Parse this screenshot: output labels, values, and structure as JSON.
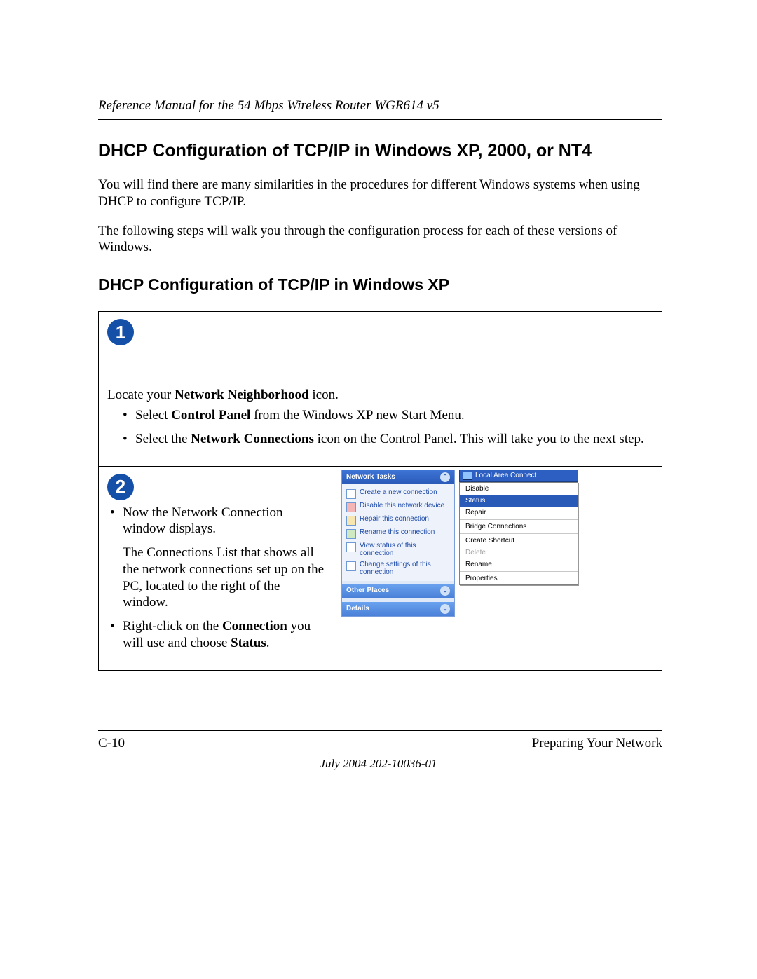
{
  "header": {
    "running_head": "Reference Manual for the 54 Mbps Wireless Router WGR614 v5"
  },
  "headings": {
    "h2": "DHCP Configuration of TCP/IP in Windows XP, 2000, or NT4",
    "h3": "DHCP Configuration of TCP/IP in Windows XP"
  },
  "paragraphs": {
    "p1": "You will find there are many similarities in the procedures for different Windows systems when using DHCP to configure TCP/IP.",
    "p2": "The following steps will walk you through the configuration process for each of these versions of Windows."
  },
  "step1": {
    "badge": "1",
    "lead_pre": "Locate your ",
    "lead_bold": "Network Neighborhood",
    "lead_post": " icon.",
    "b1_pre": "Select ",
    "b1_bold": "Control Panel",
    "b1_post": " from the Windows XP new Start Menu.",
    "b2_pre": "Select the ",
    "b2_bold": "Network Connections",
    "b2_post": " icon on the Control Panel.  This will take you to the next step."
  },
  "step2": {
    "badge": "2",
    "b1": "Now the Network Connection window displays.",
    "b1_follow": "The Connections List that shows all the network connections set up on the PC, located to the right of the window.",
    "b2_pre": "Right-click on the ",
    "b2_bold1": "Connection",
    "b2_mid": " you will use and choose ",
    "b2_bold2": "Status",
    "b2_post": "."
  },
  "xp_panel": {
    "tasks_title": "Network Tasks",
    "items": [
      "Create a new connection",
      "Disable this network device",
      "Repair this connection",
      "Rename this connection",
      "View status of this connection",
      "Change settings of this connection"
    ],
    "other_places": "Other Places",
    "details": "Details"
  },
  "context": {
    "lac": "Local Area Connect",
    "items": [
      "Disable",
      "Status",
      "Repair",
      "Bridge Connections",
      "Create Shortcut",
      "Delete",
      "Rename",
      "Properties"
    ],
    "selected": "Status",
    "disabled": "Delete"
  },
  "footer": {
    "page_num": "C-10",
    "section": "Preparing Your Network",
    "date_line": "July 2004 202-10036-01"
  }
}
